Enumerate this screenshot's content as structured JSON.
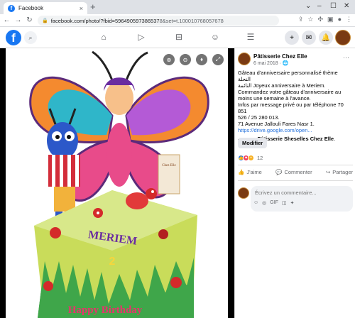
{
  "browser": {
    "tab_title": "Facebook",
    "tab_favicon": "f",
    "close_glyph": "×",
    "new_tab_glyph": "+",
    "url_main": "facebook.com/photo/?fbid=596490597386537",
    "url_rest": "8&set=t.100010768057678",
    "window_controls": [
      "⌄",
      "–",
      "☐",
      "✕"
    ]
  },
  "facebook": {
    "logo": "f",
    "nav_icons": [
      "home-icon",
      "watch-icon",
      "marketplace-icon",
      "groups-icon",
      "menu-icon"
    ],
    "nav_glyphs": [
      "⌂",
      "▷",
      "⊟",
      "☺",
      "☰"
    ],
    "header_icons": [
      "+",
      "✉",
      "🔔"
    ],
    "header_avatar": "Pâtisserie"
  },
  "photo": {
    "cake_text": "MERIEM",
    "cake_number": "2",
    "happy_birthday": "Happy Birthday",
    "topper_label": "Chez Elle",
    "controls": [
      "⊕",
      "⊖",
      "⬧",
      "⤢"
    ]
  },
  "post": {
    "page_name": "Pâtisserie Chez Elle",
    "date": "6 mai 2018 · 🌐",
    "more": "···",
    "text_lines": [
      "Gâteau d'anniversaire personnalisé thème النحلة",
      "النائمة Joyeux anniversaire à Meriem.",
      "Commandez votre gâteau d'anniversaire au",
      "moins une semaine à l'avance.",
      "Infos par message privé ou par téléphone 70 851",
      "526 / 25 280 013.",
      "71 Avenue Jallouli Fares Nasr 1."
    ],
    "link": "https://drive.google.com/open...",
    "with_text": "— avec ",
    "with_name": "Pâtisserie Sheselles Chez Elle",
    "with_end": ".",
    "edit_button": "Modifier",
    "reaction_count": "12",
    "actions": {
      "like": "J'aime",
      "comment": "Commenter",
      "share": "Partager"
    },
    "comment_placeholder": "Écrivez un commentaire...",
    "comment_icons": [
      "☺",
      "◎",
      "GIF",
      "◫",
      "✦"
    ]
  },
  "colors": {
    "fb_blue": "#1877f2",
    "link_blue": "#216fdb",
    "like_blue": "#2078f4",
    "love_red": "#f33e58",
    "wow_yellow": "#f7b125"
  }
}
